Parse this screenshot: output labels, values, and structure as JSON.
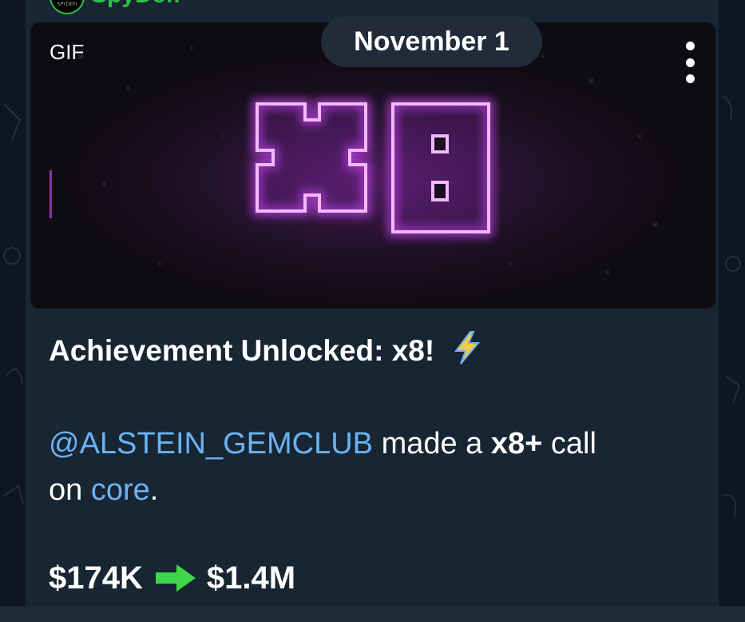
{
  "sender": {
    "name": "SpyDefi",
    "avatar_text": "SPYDEFI"
  },
  "media": {
    "badge": "GIF",
    "overlay_text": "x8",
    "more_icon": "vertical-dots-icon"
  },
  "date_pill": "November 1",
  "message": {
    "title": "Achievement Unlocked: x8!",
    "title_emoji": "lightning-icon",
    "mention": "@ALSTEIN_GEMCLUB",
    "text_made": " made a ",
    "multiplier": "x8+",
    "text_call": " call",
    "text_on": "on ",
    "token": "core",
    "text_period": ".",
    "price_from": "$174K",
    "arrow_icon": "green-right-arrow-icon",
    "price_to": "$1.4M"
  },
  "colors": {
    "bubble": "#182533",
    "background": "#0e1621",
    "link": "#6ab3f3",
    "sender": "#2fbf48",
    "neon": "#d24bff"
  }
}
